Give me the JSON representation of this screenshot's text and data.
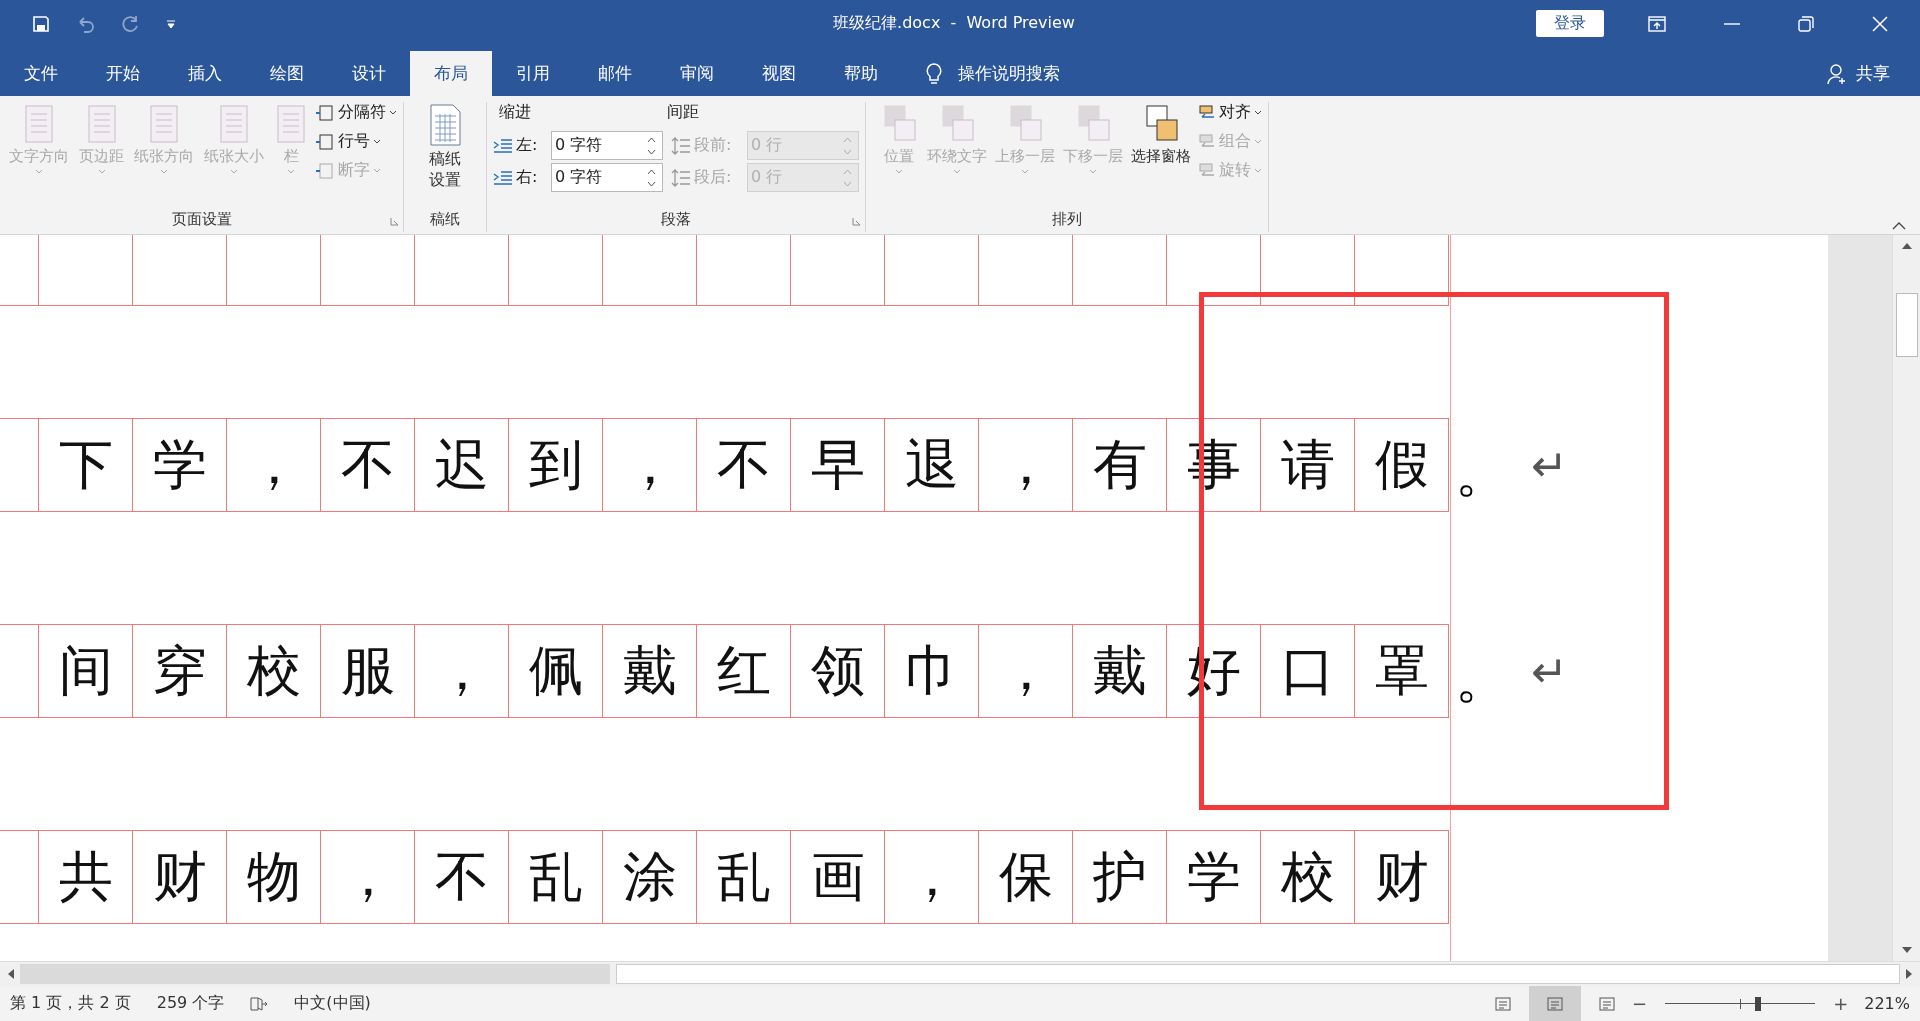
{
  "title_bar": {
    "title": "班级纪律.docx  -  Word Preview",
    "login": "登录"
  },
  "tabs": [
    {
      "label": "文件",
      "selected": false
    },
    {
      "label": "开始",
      "selected": false
    },
    {
      "label": "插入",
      "selected": false
    },
    {
      "label": "绘图",
      "selected": false
    },
    {
      "label": "设计",
      "selected": false
    },
    {
      "label": "布局",
      "selected": true
    },
    {
      "label": "引用",
      "selected": false
    },
    {
      "label": "邮件",
      "selected": false
    },
    {
      "label": "审阅",
      "selected": false
    },
    {
      "label": "视图",
      "selected": false
    },
    {
      "label": "帮助",
      "selected": false
    }
  ],
  "tell_me": "操作说明搜索",
  "share": "共享",
  "ribbon": {
    "page_setup": {
      "label": "页面设置",
      "large": [
        {
          "label": "文字方向",
          "disabled": true
        },
        {
          "label": "页边距",
          "disabled": true
        },
        {
          "label": "纸张方向",
          "disabled": true
        },
        {
          "label": "纸张大小",
          "disabled": true
        },
        {
          "label": "栏",
          "disabled": true
        }
      ],
      "small": [
        {
          "label": "分隔符",
          "disabled": false
        },
        {
          "label": "行号",
          "disabled": false
        },
        {
          "label": "断字",
          "disabled": true
        }
      ]
    },
    "manuscript": {
      "label": "稿纸",
      "button": {
        "label": "稿纸设置",
        "disabled": false
      }
    },
    "paragraph": {
      "label": "段落",
      "indent_label": "缩进",
      "spacing_label": "间距",
      "indent": [
        {
          "label": "左:",
          "value": "0 字符",
          "disabled": false
        },
        {
          "label": "右:",
          "value": "0 字符",
          "disabled": false
        }
      ],
      "spacing": [
        {
          "label": "段前:",
          "value": "0 行",
          "disabled": true
        },
        {
          "label": "段后:",
          "value": "0 行",
          "disabled": true
        }
      ]
    },
    "arrange": {
      "label": "排列",
      "large": [
        {
          "label": "位置",
          "disabled": true
        },
        {
          "label": "环绕文字",
          "disabled": true
        },
        {
          "label": "上移一层",
          "disabled": true
        },
        {
          "label": "下移一层",
          "disabled": true
        },
        {
          "label": "选择窗格",
          "disabled": false
        }
      ],
      "small": [
        {
          "label": "对齐",
          "disabled": false
        },
        {
          "label": "组合",
          "disabled": true
        },
        {
          "label": "旋转",
          "disabled": true
        }
      ]
    }
  },
  "document": {
    "rows": [
      {
        "cells": [
          "下",
          "学",
          "，",
          "不",
          "迟",
          "到",
          "，",
          "不",
          "早",
          "退",
          "，",
          "有",
          "事",
          "请",
          "假"
        ],
        "end": "。",
        "mark": "↵"
      },
      {
        "cells": [
          "间",
          "穿",
          "校",
          "服",
          "，",
          "佩",
          "戴",
          "红",
          "领",
          "巾",
          "，",
          "戴",
          "好",
          "口",
          "罩"
        ],
        "end": "。",
        "mark": "↵"
      },
      {
        "cells": [
          "共",
          "财",
          "物",
          "，",
          "不",
          "乱",
          "涂",
          "乱",
          "画",
          "，",
          "保",
          "护",
          "学",
          "校",
          "财"
        ]
      }
    ]
  },
  "status_bar": {
    "page": "第 1 页，共 2 页",
    "words": "259 个字",
    "language": "中文(中国)",
    "views": [
      {
        "selected": false
      },
      {
        "selected": true
      },
      {
        "selected": false
      }
    ],
    "zoom": {
      "out": "−",
      "in": "+",
      "level": 0.62,
      "reading": "221%"
    }
  }
}
